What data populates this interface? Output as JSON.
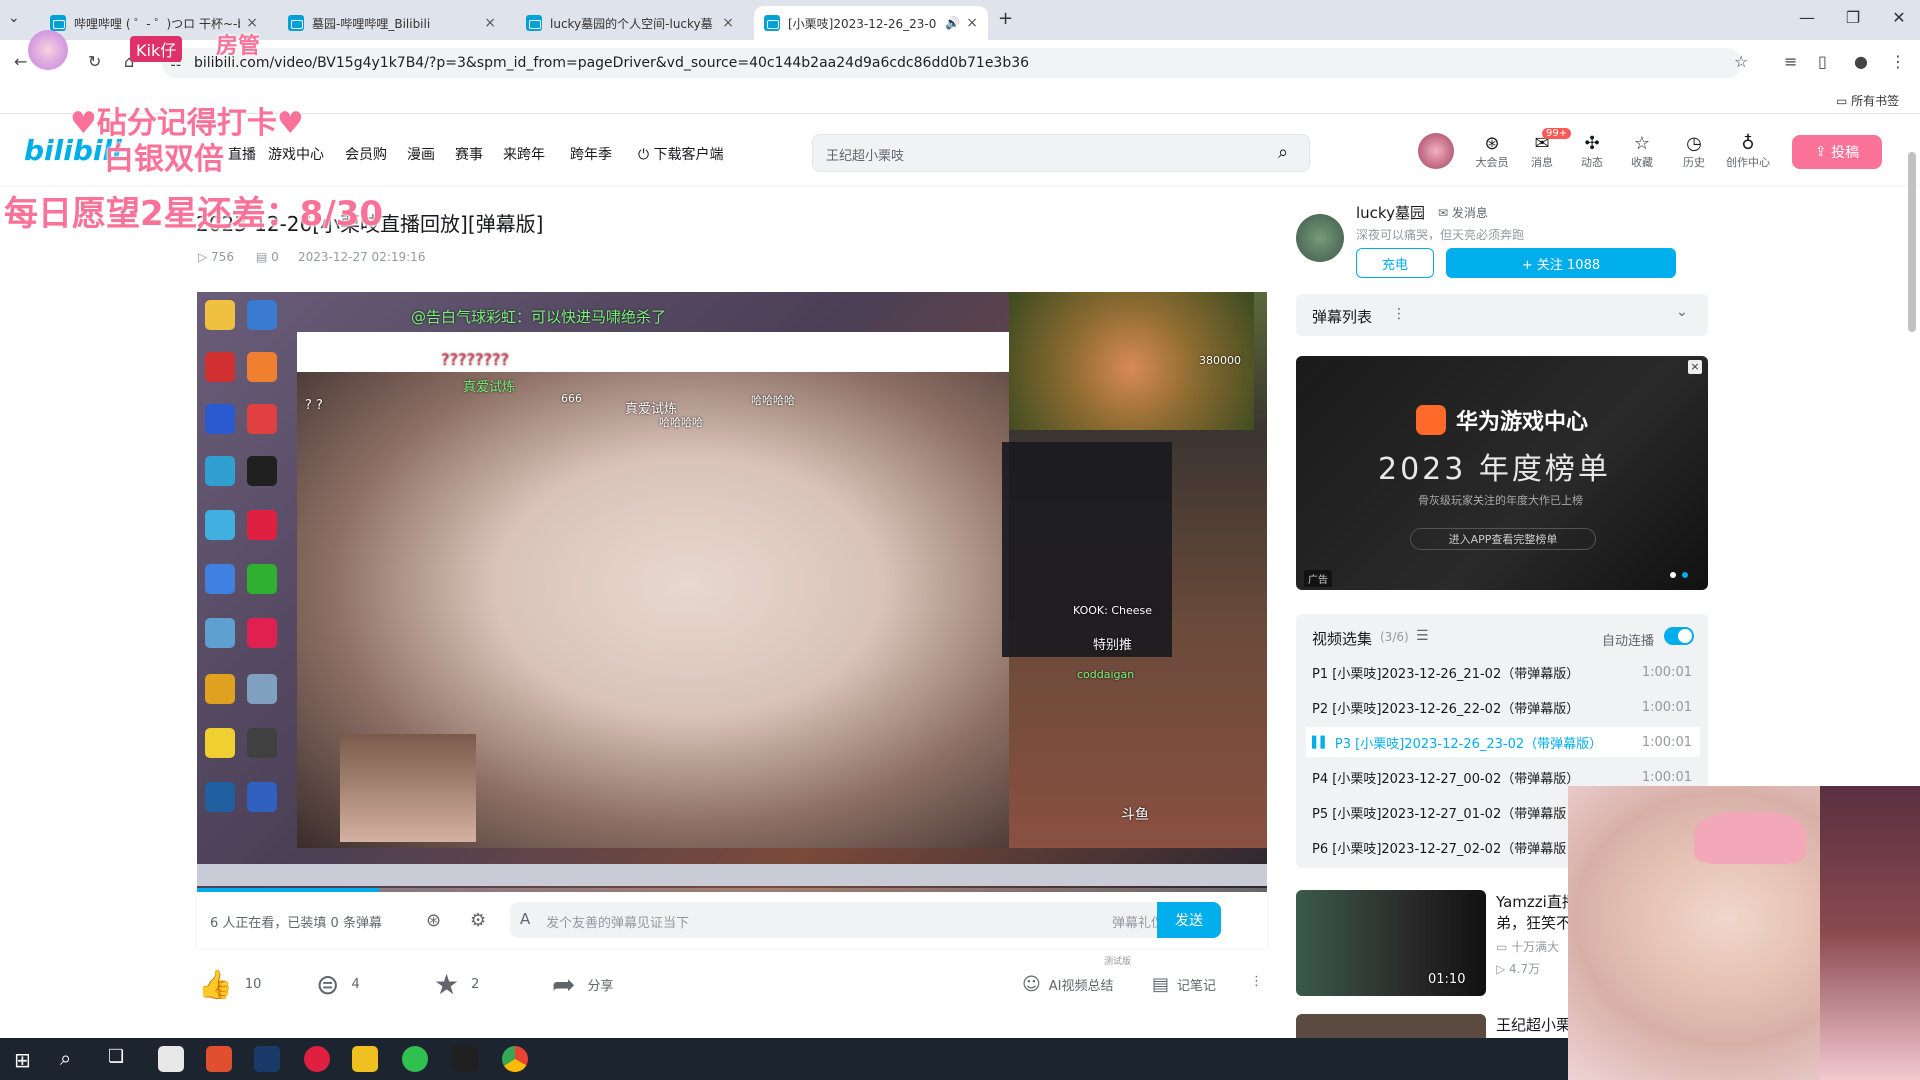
{
  "browser": {
    "tabs": [
      {
        "label": "哔哩哔哩 ( ゜- ゜)つロ 干杯~-bi"
      },
      {
        "label": "墓园-哔哩哔哩_Bilibili"
      },
      {
        "label": "lucky墓园的个人空间-lucky墓"
      },
      {
        "label": "[小栗吱]2023-12-26_23-0"
      }
    ],
    "url": "bilibili.com/video/BV15g4y1k7B4/?p=3&spm_id_from=pageDriver&vd_source=40c144b2aa24d9a6cdc86dd0b71e3b36",
    "bookmarks_label": "所有书签"
  },
  "header": {
    "logo": "bilibili",
    "nav": [
      "直播",
      "游戏中心",
      "会员购",
      "漫画",
      "赛事",
      "来跨年",
      "跨年季",
      "下载客户端"
    ],
    "search_placeholder": "王纪超小栗吱",
    "icons": [
      {
        "label": "大会员",
        "icon": "vip-icon"
      },
      {
        "label": "消息",
        "icon": "message-icon",
        "badge": "99+"
      },
      {
        "label": "动态",
        "icon": "dynamic-icon"
      },
      {
        "label": "收藏",
        "icon": "star-icon"
      },
      {
        "label": "历史",
        "icon": "clock-icon"
      },
      {
        "label": "创作中心",
        "icon": "bulb-icon"
      }
    ],
    "upload_label": "投稿"
  },
  "video": {
    "title": "2023-12-26[小栗吱直播回放][弹幕版]",
    "views": "756",
    "danmaku_count": "0",
    "date": "2023-12-27 02:19:16"
  },
  "player": {
    "progress": 0.17,
    "danmaku": [
      {
        "text": "@告白气球彩虹：可以快进马啸绝杀了",
        "green": true
      },
      {
        "text": "????????",
        "green": false
      },
      {
        "text": "真爱试炼",
        "green": true
      },
      {
        "text": "666",
        "green": false
      },
      {
        "text": "真爱试炼",
        "green": false
      },
      {
        "text": "哈哈哈哈",
        "green": false
      },
      {
        "text": "哈哈哈哈",
        "green": false
      },
      {
        "text": "? ?",
        "green": false
      },
      {
        "text": "KOOK: Cheese",
        "green": false
      },
      {
        "text": "特别推",
        "green": false
      },
      {
        "text": "coddaigan",
        "green": true
      },
      {
        "text": "380000",
        "green": false
      },
      {
        "text": "斗鱼",
        "green": false
      }
    ]
  },
  "danmaku_bar": {
    "watching": "6 人正在看，已装填 0 条弹幕",
    "placeholder": "发个友善的弹幕见证当下",
    "gift": "弹幕礼仪 >",
    "send": "发送"
  },
  "actions": {
    "like": "10",
    "coin": "4",
    "fav": "2",
    "share": "分享",
    "ai_summary": "AI视频总结",
    "ai_badge": "测试版",
    "notes": "记笔记"
  },
  "uploader": {
    "name": "lucky墓园",
    "message": "发消息",
    "sign": "深夜可以痛哭，但天亮必须奔跑",
    "charge": "充电",
    "follow": "+ 关注 1088"
  },
  "danmaku_list": {
    "label": "弹幕列表"
  },
  "ad": {
    "brand": "华为游戏中心",
    "headline": "2023 年度榜单",
    "sub": "骨灰级玩家关注的年度大作已上榜",
    "button": "进入APP查看完整榜单",
    "tag": "广告"
  },
  "playlist": {
    "title": "视频选集",
    "count": "(3/6)",
    "autoplay": "自动连播",
    "items": [
      {
        "label": "P1  [小栗吱]2023-12-26_21-02（带弹幕版）",
        "dur": "1:00:01"
      },
      {
        "label": "P2  [小栗吱]2023-12-26_22-02（带弹幕版）",
        "dur": "1:00:01"
      },
      {
        "label": "P3  [小栗吱]2023-12-26_23-02（带弹幕版）",
        "dur": "1:00:01"
      },
      {
        "label": "P4  [小栗吱]2023-12-27_00-02（带弹幕版）",
        "dur": "1:00:01"
      },
      {
        "label": "P5  [小栗吱]2023-12-27_01-02（带弹幕版",
        "dur": ""
      },
      {
        "label": "P6  [小栗吱]2023-12-27_02-02（带弹幕版",
        "dur": ""
      }
    ]
  },
  "recommend": [
    {
      "title_line1": "Yamzzi直播",
      "title_line2": "弟，狂笑不",
      "up": "十万满大",
      "views": "4.7万",
      "dur": "01:10"
    },
    {
      "title_line1": "王纪超小栗"
    }
  ],
  "overlay": {
    "badge": "Kik仔",
    "line1": "房管",
    "line2": "♥砧分记得打卡♥",
    "line3": "白银双倍",
    "line4": "每日愿望2星还差：8/30"
  }
}
